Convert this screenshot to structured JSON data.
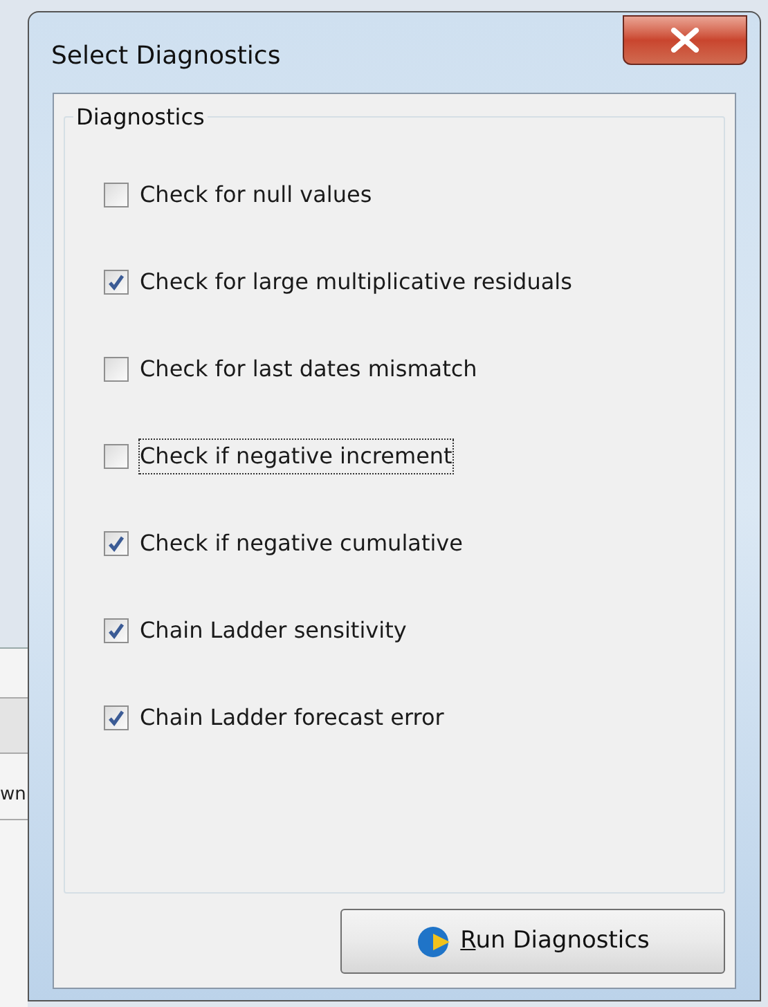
{
  "background_window": {
    "cell_text": "wn"
  },
  "window": {
    "title": "Select Diagnostics"
  },
  "group": {
    "title": "Diagnostics",
    "items": [
      {
        "label": "Check for null values",
        "checked": false,
        "focused": false
      },
      {
        "label": "Check for large multiplicative residuals",
        "checked": true,
        "focused": false
      },
      {
        "label": "Check for last dates mismatch",
        "checked": false,
        "focused": false
      },
      {
        "label": "Check if negative increment",
        "checked": false,
        "focused": true
      },
      {
        "label": "Check if negative cumulative",
        "checked": true,
        "focused": false
      },
      {
        "label": "Chain Ladder sensitivity",
        "checked": true,
        "focused": false
      },
      {
        "label": "Chain Ladder forecast error",
        "checked": true,
        "focused": false
      }
    ]
  },
  "button": {
    "label": "Run Diagnostics"
  }
}
